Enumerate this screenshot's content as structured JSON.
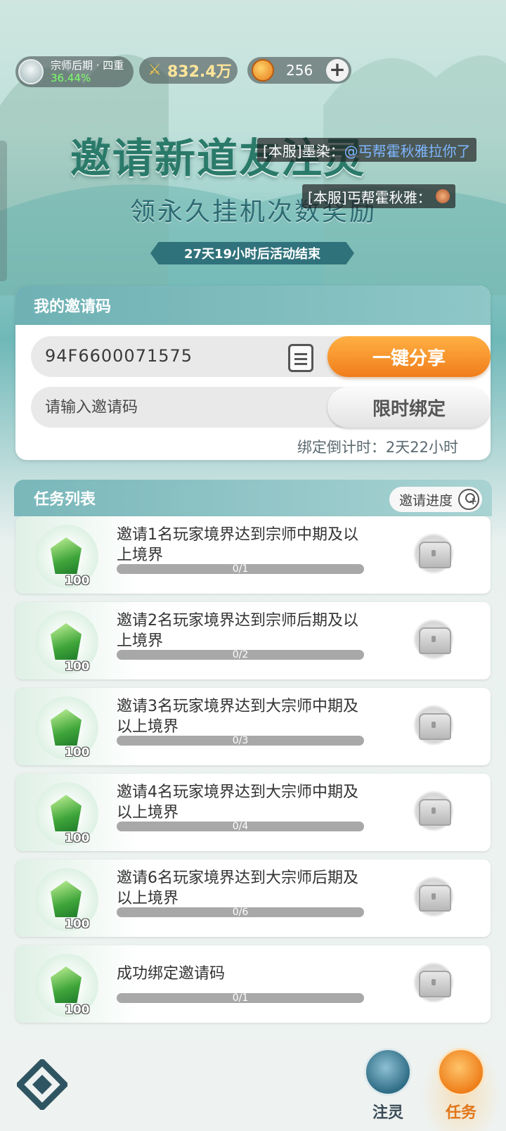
{
  "status": {
    "rank_name": "宗师后期 · 四重",
    "rank_percent": "36.44%",
    "power": "832.4万",
    "coins": "256",
    "plus_label": "+"
  },
  "banner": {
    "title": "邀请新道友注灵",
    "subtitle": "领永久挂机次数奖励",
    "countdown": "27天19小时后活动结束"
  },
  "chat": [
    {
      "prefix": "[本服]墨染：",
      "mention": "@丐帮霍秋雅拉你了"
    },
    {
      "prefix": "[本服]丐帮霍秋雅：",
      "mention": ""
    }
  ],
  "invite": {
    "header": "我的邀请码",
    "code": "94F6600071575",
    "share_label": "一键分享",
    "input_placeholder": "请输入邀请码",
    "bind_label": "限时绑定",
    "bind_countdown": "绑定倒计时：2天22小时"
  },
  "tasks": {
    "header": "任务列表",
    "progress_button": "邀请进度",
    "items": [
      {
        "title": "邀请1名玩家境界达到宗师中期及以上境界",
        "reward": "100",
        "progress": "0/1",
        "fraction": 0
      },
      {
        "title": "邀请2名玩家境界达到宗师后期及以上境界",
        "reward": "100",
        "progress": "0/2",
        "fraction": 0
      },
      {
        "title": "邀请3名玩家境界达到大宗师中期及以上境界",
        "reward": "100",
        "progress": "0/3",
        "fraction": 0
      },
      {
        "title": "邀请4名玩家境界达到大宗师中期及以上境界",
        "reward": "100",
        "progress": "0/4",
        "fraction": 0
      },
      {
        "title": "邀请6名玩家境界达到大宗师后期及以上境界",
        "reward": "100",
        "progress": "0/6",
        "fraction": 0
      },
      {
        "title": "成功绑定邀请码",
        "reward": "100",
        "progress": "0/1",
        "fraction": 0
      }
    ]
  },
  "nav": {
    "spirit_label": "注灵",
    "task_label": "任务"
  },
  "icons": {
    "rank": "sage-avatar-icon",
    "power": "crossed-swords-icon",
    "coin": "spirit-coin-icon",
    "copy": "copy-icon",
    "reward": "green-jade-gem-icon",
    "chest": "treasure-chest-icon",
    "progress": "add-user-icon",
    "home": "diamond-logo-icon",
    "spirit": "spirit-leaf-icon",
    "task": "scroll-task-icon"
  },
  "colors": {
    "accent_orange": "#f07d1b",
    "teal_header": "#6fb1b4",
    "rank_percent_green": "#7dff6b",
    "power_gold": "#ffe59a",
    "mention_blue": "#7fb6ff"
  }
}
